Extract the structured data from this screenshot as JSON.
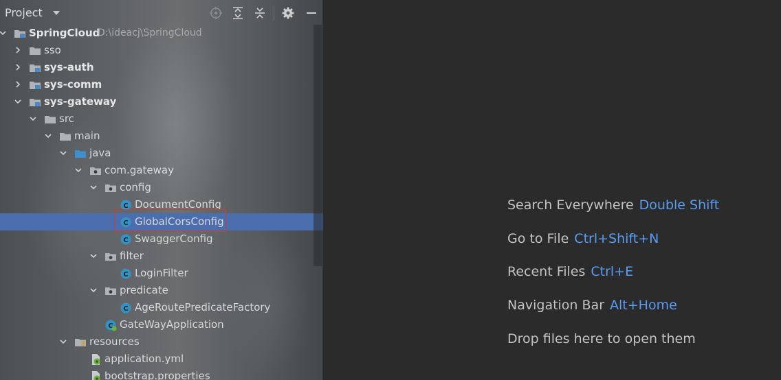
{
  "project_panel": {
    "title": "Project",
    "tree": [
      {
        "label": "SpringCloud",
        "path": "D:\\ideacj\\SpringCloud",
        "bold": true,
        "expanded": true,
        "icon": "module-folder-icon"
      },
      {
        "label": "sso",
        "bold": false,
        "expanded": false,
        "icon": "folder-icon"
      },
      {
        "label": "sys-auth",
        "bold": true,
        "expanded": false,
        "icon": "module-folder-icon"
      },
      {
        "label": "sys-comm",
        "bold": true,
        "expanded": false,
        "icon": "module-folder-icon"
      },
      {
        "label": "sys-gateway",
        "bold": true,
        "expanded": true,
        "icon": "module-folder-icon"
      },
      {
        "label": "src",
        "bold": false,
        "expanded": true,
        "icon": "folder-icon"
      },
      {
        "label": "main",
        "bold": false,
        "expanded": true,
        "icon": "folder-icon"
      },
      {
        "label": "java",
        "bold": false,
        "expanded": true,
        "icon": "source-folder-icon"
      },
      {
        "label": "com.gateway",
        "bold": false,
        "expanded": true,
        "icon": "package-icon"
      },
      {
        "label": "config",
        "bold": false,
        "expanded": true,
        "icon": "package-icon"
      },
      {
        "label": "DocumentConfig",
        "bold": false,
        "icon": "java-class-icon"
      },
      {
        "label": "GlobalCorsConfig",
        "bold": false,
        "icon": "java-class-icon",
        "selected": true
      },
      {
        "label": "SwaggerConfig",
        "bold": false,
        "icon": "java-class-icon"
      },
      {
        "label": "filter",
        "bold": false,
        "expanded": true,
        "icon": "package-icon"
      },
      {
        "label": "LoginFilter",
        "bold": false,
        "icon": "java-class-icon"
      },
      {
        "label": "predicate",
        "bold": false,
        "expanded": true,
        "icon": "package-icon"
      },
      {
        "label": "AgeRoutePredicateFactory",
        "bold": false,
        "icon": "java-class-icon"
      },
      {
        "label": "GateWayApplication",
        "bold": false,
        "icon": "spring-boot-class-icon"
      },
      {
        "label": "resources",
        "bold": false,
        "expanded": true,
        "icon": "resources-folder-icon"
      },
      {
        "label": "application.yml",
        "bold": false,
        "icon": "spring-config-icon"
      },
      {
        "label": "bootstrap.properties",
        "bold": false,
        "icon": "spring-config-icon"
      }
    ]
  },
  "toolbar_icons": [
    "locate-icon",
    "expand-all-icon",
    "collapse-all-icon",
    "gear-icon",
    "hide-icon"
  ],
  "welcome": {
    "hints": [
      {
        "text": "Search Everywhere",
        "shortcut": "Double Shift"
      },
      {
        "text": "Go to File",
        "shortcut": "Ctrl+Shift+N"
      },
      {
        "text": "Recent Files",
        "shortcut": "Ctrl+E"
      },
      {
        "text": "Navigation Bar",
        "shortcut": "Alt+Home"
      },
      {
        "text": "Drop files here to open them",
        "shortcut": ""
      }
    ]
  },
  "colors": {
    "selection": "#4b6eaf",
    "shortcut": "#589df6",
    "highlight_box": "#d23a3a",
    "editor_bg": "#2b2b2b"
  }
}
